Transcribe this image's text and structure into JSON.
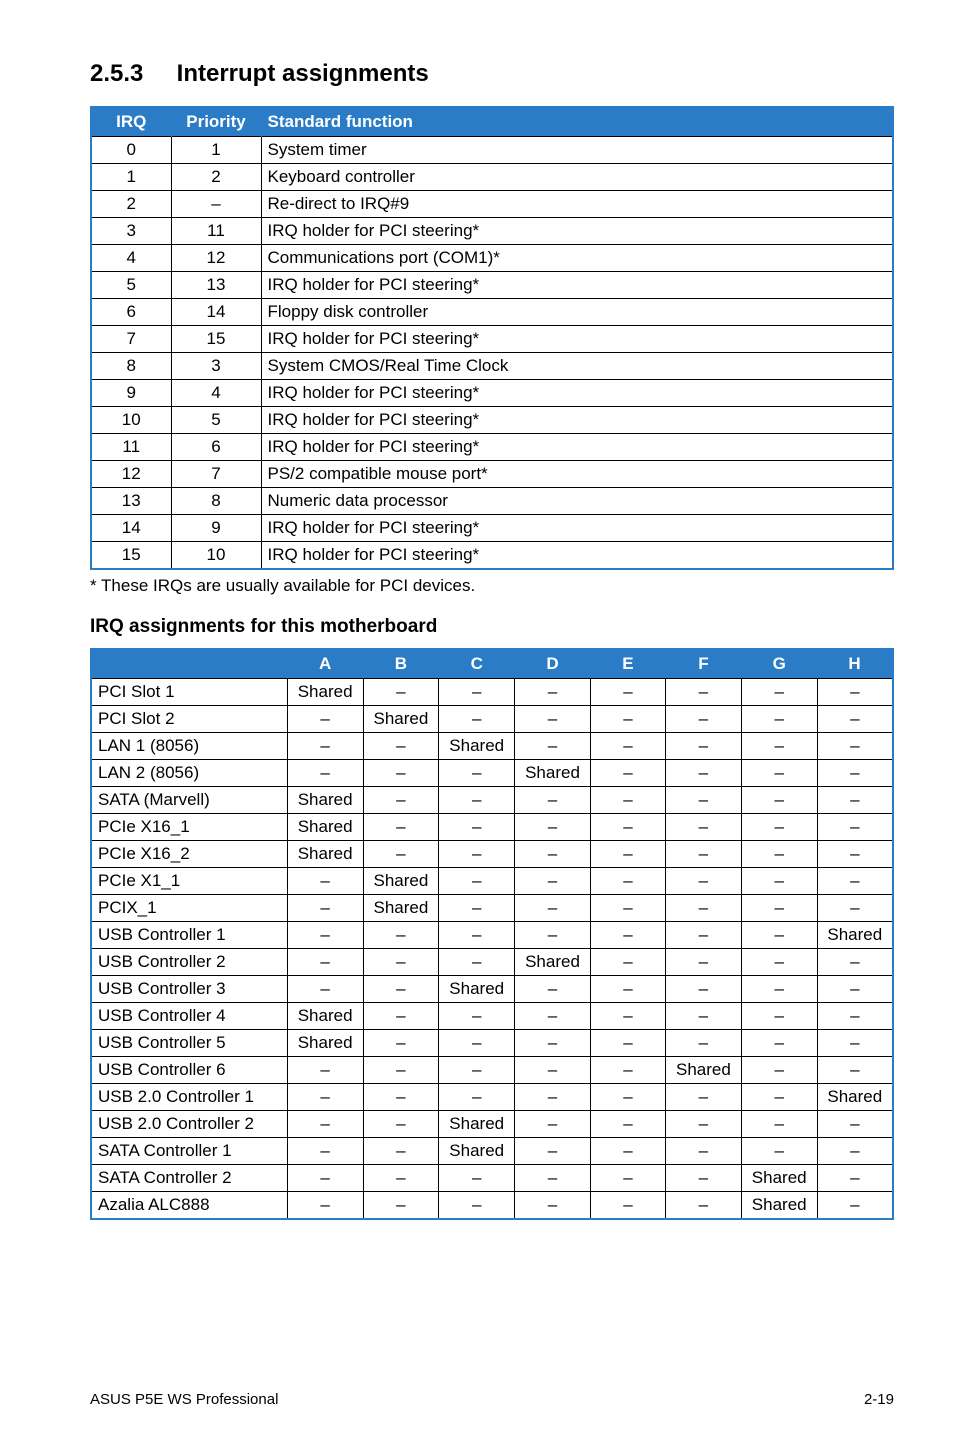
{
  "section_num": "2.5.3",
  "section_title": "Interrupt assignments",
  "irq_headers": [
    "IRQ",
    "Priority",
    "Standard function"
  ],
  "irq_rows": [
    {
      "irq": "0",
      "prio": "1",
      "fn": "System timer"
    },
    {
      "irq": "1",
      "prio": "2",
      "fn": "Keyboard controller"
    },
    {
      "irq": "2",
      "prio": "–",
      "fn": "Re-direct to IRQ#9"
    },
    {
      "irq": "3",
      "prio": "11",
      "fn": "IRQ holder for PCI steering*"
    },
    {
      "irq": "4",
      "prio": "12",
      "fn": "Communications port (COM1)*"
    },
    {
      "irq": "5",
      "prio": "13",
      "fn": "IRQ holder for PCI steering*"
    },
    {
      "irq": "6",
      "prio": "14",
      "fn": "Floppy disk controller"
    },
    {
      "irq": "7",
      "prio": "15",
      "fn": "IRQ holder for PCI steering*"
    },
    {
      "irq": "8",
      "prio": "3",
      "fn": "System CMOS/Real Time Clock"
    },
    {
      "irq": "9",
      "prio": "4",
      "fn": "IRQ holder for PCI steering*"
    },
    {
      "irq": "10",
      "prio": "5",
      "fn": "IRQ holder for PCI steering*"
    },
    {
      "irq": "11",
      "prio": "6",
      "fn": "IRQ holder for PCI steering*"
    },
    {
      "irq": "12",
      "prio": "7",
      "fn": "PS/2 compatible mouse port*"
    },
    {
      "irq": "13",
      "prio": "8",
      "fn": "Numeric data processor"
    },
    {
      "irq": "14",
      "prio": "9",
      "fn": "IRQ holder for PCI steering*"
    },
    {
      "irq": "15",
      "prio": "10",
      "fn": "IRQ holder for PCI steering*"
    }
  ],
  "footnote": "* These IRQs are usually available for PCI devices.",
  "subheading": "IRQ assignments for this motherboard",
  "mb_headers": [
    "A",
    "B",
    "C",
    "D",
    "E",
    "F",
    "G",
    "H"
  ],
  "mb_rows": [
    {
      "label": "PCI Slot 1",
      "v": [
        "Shared",
        "–",
        "–",
        "–",
        "–",
        "–",
        "–",
        "–"
      ]
    },
    {
      "label": "PCI Slot 2",
      "v": [
        "–",
        "Shared",
        "–",
        "–",
        "–",
        "–",
        "–",
        "–"
      ]
    },
    {
      "label": "LAN 1 (8056)",
      "v": [
        "–",
        "–",
        "Shared",
        "–",
        "–",
        "–",
        "–",
        "–"
      ]
    },
    {
      "label": "LAN 2 (8056)",
      "v": [
        "–",
        "–",
        "–",
        "Shared",
        "–",
        "–",
        "–",
        "–"
      ]
    },
    {
      "label": "SATA (Marvell)",
      "v": [
        "Shared",
        "–",
        "–",
        "–",
        "–",
        "–",
        "–",
        "–"
      ]
    },
    {
      "label": "PCIe X16_1",
      "v": [
        "Shared",
        "–",
        "–",
        "–",
        "–",
        "–",
        "–",
        "–"
      ]
    },
    {
      "label": "PCIe X16_2",
      "v": [
        "Shared",
        "–",
        "–",
        "–",
        "–",
        "–",
        "–",
        "–"
      ]
    },
    {
      "label": "PCIe X1_1",
      "v": [
        "–",
        "Shared",
        "–",
        "–",
        "–",
        "–",
        "–",
        "–"
      ]
    },
    {
      "label": "PCIX_1",
      "v": [
        "–",
        "Shared",
        "–",
        "–",
        "–",
        "–",
        "–",
        "–"
      ]
    },
    {
      "label": "USB Controller 1",
      "v": [
        "–",
        "–",
        "–",
        "–",
        "–",
        "–",
        "–",
        "Shared"
      ]
    },
    {
      "label": "USB Controller 2",
      "v": [
        "–",
        "–",
        "–",
        "Shared",
        "–",
        "–",
        "–",
        "–"
      ]
    },
    {
      "label": "USB Controller 3",
      "v": [
        "–",
        "–",
        "Shared",
        "–",
        "–",
        "–",
        "–",
        "–"
      ]
    },
    {
      "label": "USB Controller 4",
      "v": [
        "Shared",
        "–",
        "–",
        "–",
        "–",
        "–",
        "–",
        "–"
      ]
    },
    {
      "label": "USB Controller 5",
      "v": [
        "Shared",
        "–",
        "–",
        "–",
        "–",
        "–",
        "–",
        "–"
      ]
    },
    {
      "label": "USB Controller 6",
      "v": [
        "–",
        "–",
        "–",
        "–",
        "–",
        "Shared",
        "–",
        "–"
      ]
    },
    {
      "label": "USB 2.0 Controller 1",
      "v": [
        "–",
        "–",
        "–",
        "–",
        "–",
        "–",
        "–",
        "Shared"
      ]
    },
    {
      "label": "USB 2.0 Controller 2",
      "v": [
        "–",
        "–",
        "Shared",
        "–",
        "–",
        "–",
        "–",
        "–"
      ]
    },
    {
      "label": "SATA Controller 1",
      "v": [
        "–",
        "–",
        "Shared",
        "–",
        "–",
        "–",
        "–",
        "–"
      ]
    },
    {
      "label": "SATA Controller 2",
      "v": [
        "–",
        "–",
        "–",
        "–",
        "–",
        "–",
        "Shared",
        "–"
      ]
    },
    {
      "label": "Azalia ALC888",
      "v": [
        "–",
        "–",
        "–",
        "–",
        "–",
        "–",
        "Shared",
        "–"
      ]
    }
  ],
  "footer_left": "ASUS P5E WS Professional",
  "footer_right": "2-19"
}
